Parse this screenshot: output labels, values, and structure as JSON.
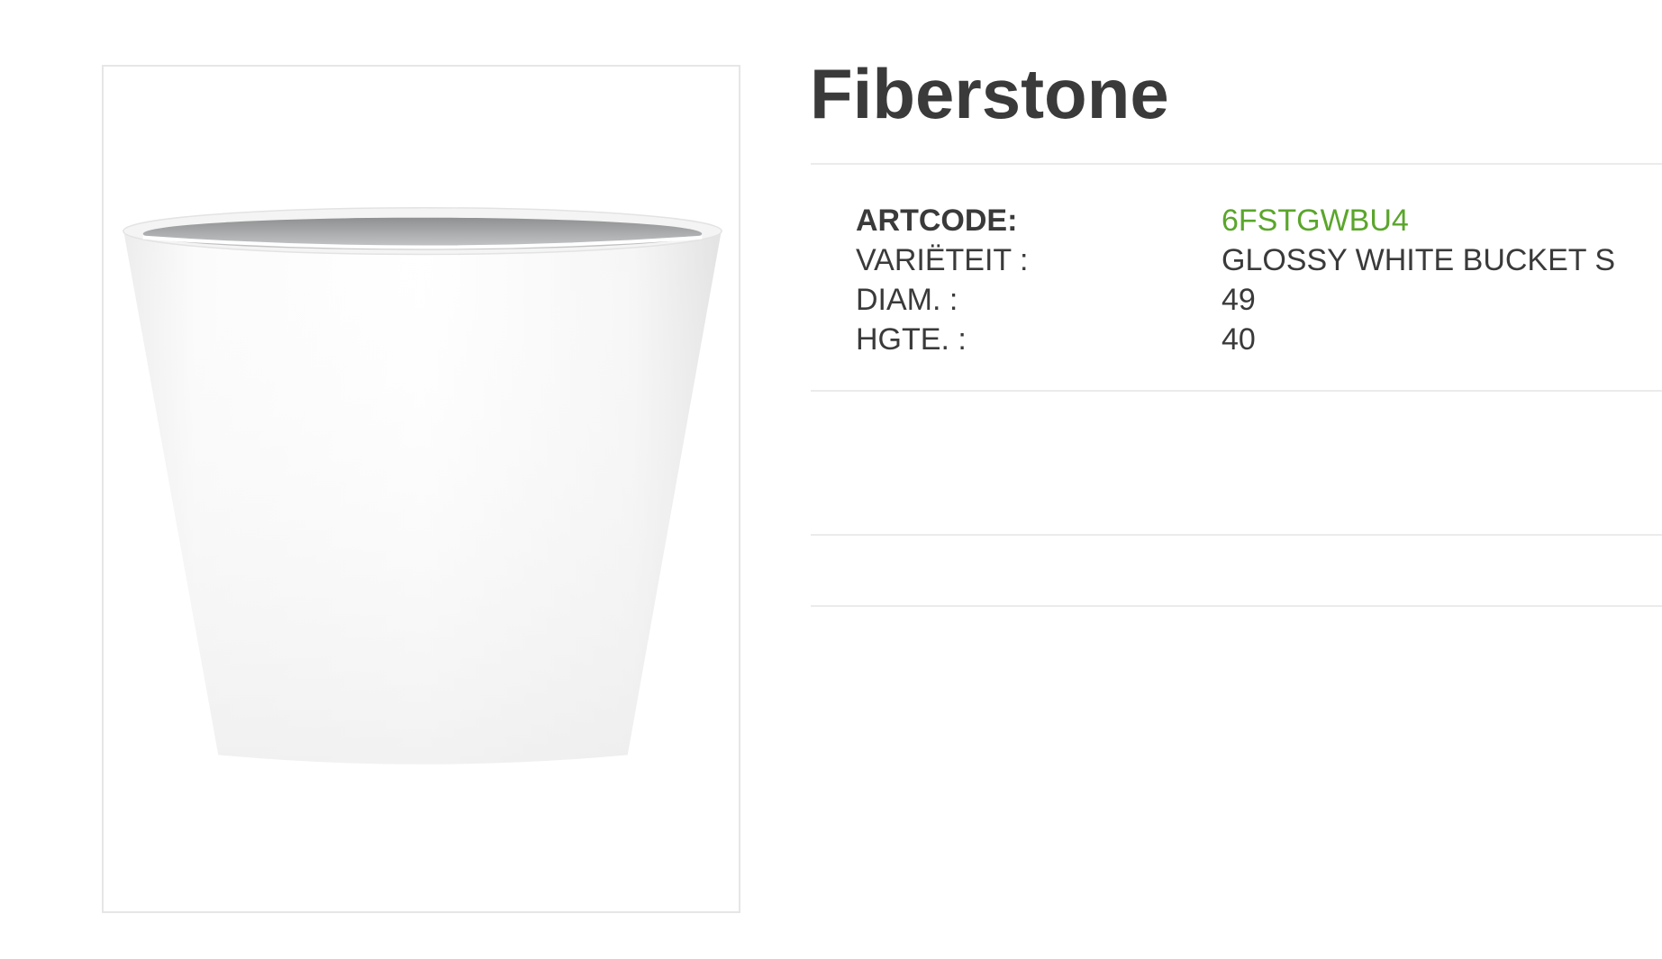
{
  "product": {
    "title": "Fiberstone",
    "image_icon": "planter-pot-icon"
  },
  "colors": {
    "text": "#3a3a3a",
    "accent": "#5aa62b",
    "rule": "#ebebeb",
    "frame": "#e6e6e6"
  },
  "specs": [
    {
      "label": "ARTCODE:",
      "value": "6FSTGWBU4"
    },
    {
      "label": "VARIËTEIT :",
      "value": "GLOSSY WHITE BUCKET S"
    },
    {
      "label": "DIAM. :",
      "value": "49"
    },
    {
      "label": "HGTE. :",
      "value": "40"
    }
  ]
}
